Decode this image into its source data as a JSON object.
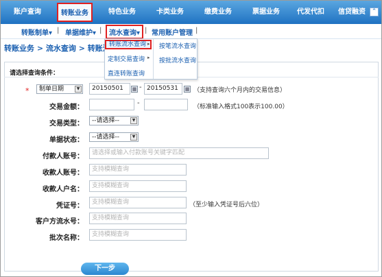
{
  "topnav": {
    "items": [
      "账户查询",
      "转账业务",
      "特色业务",
      "卡类业务",
      "缴费业务",
      "票据业务",
      "代发代扣",
      "信贷融资"
    ],
    "active_index": 1,
    "collapse_icon": "chevron-up-icon"
  },
  "subnav": {
    "items": [
      "转账制单▾",
      "单据维护▾",
      "流水查询▾",
      "常用账户管理"
    ],
    "separator": "|"
  },
  "breadcrumb": "转账业务 > 流水查询 > 转账流",
  "menu": {
    "items": [
      "转账流水查询",
      "定制交易查询",
      "直连转账查询"
    ],
    "sub_items": [
      "按笔流水查询",
      "按批流水查询"
    ],
    "arrow": "▸"
  },
  "form": {
    "title": "请选择查询条件：",
    "required_mark": "*",
    "date_type": "制单日期",
    "start_date": "20150501",
    "end_date": "20150531",
    "date_hint": "（支持查询六个月内的交易信息）",
    "amount_label": "交易金额：",
    "amount_hint": "（标准输入格式100表示100.00）",
    "type_label": "交易类型：",
    "type_value": "--请选择--",
    "status_label": "单据状态：",
    "status_value": "--请选择--",
    "payer_label": "付款人账号：",
    "payer_placeholder": "请选择或输入付款账号关键字匹配",
    "payee_account_label": "收款人账号：",
    "payee_account_placeholder": "支持模糊查询",
    "payee_name_label": "收款人户名：",
    "payee_name_placeholder": "支持模糊查询",
    "voucher_label": "凭证号：",
    "voucher_placeholder": "支持模糊查询",
    "voucher_hint": "（至少输入凭证号后六位）",
    "serial_label": "客户方流水号：",
    "serial_placeholder": "支持模糊查询",
    "batch_label": "批次名称：",
    "batch_placeholder": "支持模糊查询",
    "dash": "-",
    "next_button": "下一步"
  },
  "colors": {
    "nav_blue": "#1f72c2",
    "highlight_red": "#e02020",
    "link_blue": "#1a5fb0"
  }
}
